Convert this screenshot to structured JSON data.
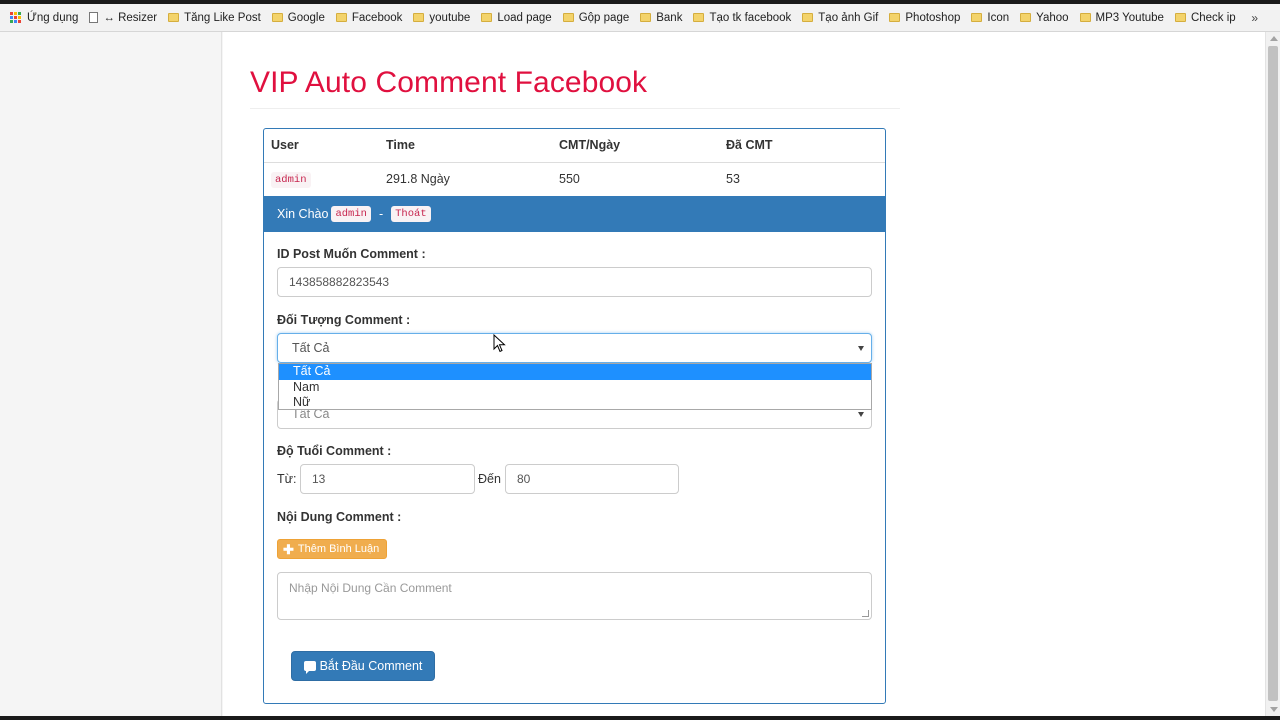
{
  "bookmarks": {
    "apps_label": "Ứng dụng",
    "items": [
      "↔ Resizer",
      "Tăng Like Post",
      "Google",
      "Facebook",
      "youtube",
      "Load page",
      "Gộp page",
      "Bank",
      "Tạo tk facebook",
      "Tạo ảnh Gif",
      "Photoshop",
      "Icon",
      "Yahoo",
      "MP3 Youtube",
      "Check ip"
    ],
    "more": "»"
  },
  "page": {
    "title": "VIP Auto Comment Facebook"
  },
  "info_table": {
    "headers": [
      "User",
      "Time",
      "CMT/Ngày",
      "Đã CMT"
    ],
    "row": {
      "user": "admin",
      "time": "291.8 Ngày",
      "per_day": "550",
      "done": "53"
    }
  },
  "greeting": {
    "text": "Xin Chào",
    "user": "admin",
    "separator": "-",
    "logout": "Thoát"
  },
  "form": {
    "post_id_label": "ID Post Muốn Comment :",
    "post_id_value": "143858882823543",
    "target_label": "Đối Tượng Comment :",
    "target_value": "Tất Cả",
    "target_options": [
      "Tất Cả",
      "Nam",
      "Nữ"
    ],
    "second_select_value": "Tất Cả",
    "age_label": "Độ Tuổi Comment :",
    "age_from_label": "Từ:",
    "age_from_value": "13",
    "age_to_label": "Đến",
    "age_to_value": "80",
    "content_label": "Nội Dung Comment :",
    "add_button": "Thêm Bình Luận",
    "content_placeholder": "Nhập Nội Dung Cần Comment",
    "start_button": "Bắt Đầu Comment"
  },
  "colors": {
    "title": "#e0103f",
    "primary": "#337ab7",
    "warning": "#f0ad4e",
    "dropdown_selected": "#1e90ff"
  }
}
